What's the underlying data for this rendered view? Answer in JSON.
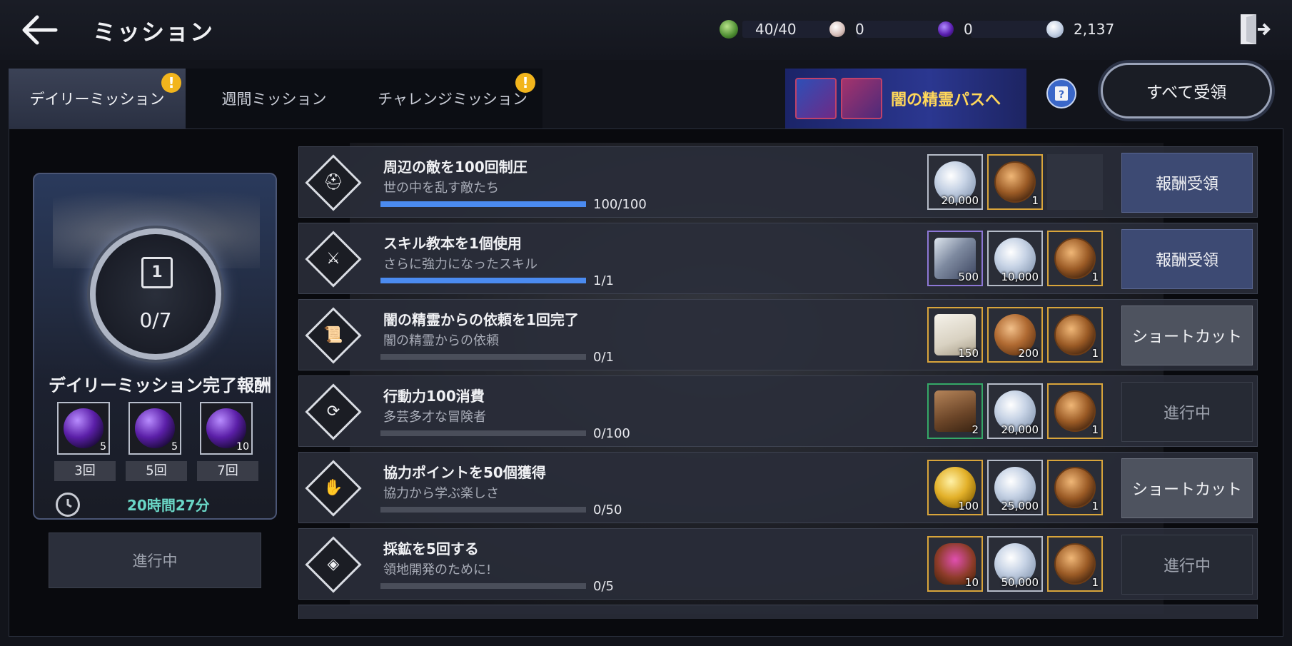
{
  "header": {
    "title": "ミッション",
    "currencies": [
      {
        "icon": "stamina-icon",
        "value": "40/40",
        "color": "#5ea64c"
      },
      {
        "icon": "pearl-icon",
        "value": "0",
        "color": "#e8d6d2"
      },
      {
        "icon": "dark-orb-icon",
        "value": "0",
        "color": "#6a2bc4"
      },
      {
        "icon": "silver-coin-icon",
        "value": "2,137",
        "color": "#c8d4e6"
      }
    ]
  },
  "tabs": [
    {
      "label": "デイリーミッション",
      "active": true,
      "alert": "!"
    },
    {
      "label": "週間ミッション",
      "active": false,
      "alert": ""
    },
    {
      "label": "チャレンジミッション",
      "active": false,
      "alert": "!"
    }
  ],
  "pass_banner": {
    "label": "闇の精霊パスへ"
  },
  "claim_all": {
    "label": "すべて受領"
  },
  "daily_panel": {
    "medal_number": "1",
    "progress": "0/7",
    "title": "デイリーミッション完了報酬",
    "rewards": [
      {
        "count": "5",
        "label": "3回"
      },
      {
        "count": "5",
        "label": "5回"
      },
      {
        "count": "10",
        "label": "7回"
      }
    ],
    "timer": "20時間27分",
    "status_button": "進行中"
  },
  "missions": [
    {
      "title": "周辺の敵を100回制圧",
      "subtitle": "世の中を乱す敵たち",
      "progress_text": "100/100",
      "progress_ratio": 1.0,
      "emblem": "helmet-icon",
      "rewards": [
        {
          "type": "silver",
          "count": "20,000"
        },
        {
          "type": "medal",
          "count": "1"
        }
      ],
      "action": "報酬受領",
      "action_state": "claim"
    },
    {
      "title": "スキル教本を1個使用",
      "subtitle": "さらに強力になったスキル",
      "progress_text": "1/1",
      "progress_ratio": 1.0,
      "emblem": "crossed-swords-icon",
      "rewards": [
        {
          "type": "crystal",
          "count": "500"
        },
        {
          "type": "silver",
          "count": "10,000"
        },
        {
          "type": "medal",
          "count": "1"
        }
      ],
      "action": "報酬受領",
      "action_state": "claim"
    },
    {
      "title": "闇の精霊からの依頼を1回完了",
      "subtitle": "闇の精霊からの依頼",
      "progress_text": "0/1",
      "progress_ratio": 0,
      "emblem": "scroll-icon",
      "rewards": [
        {
          "type": "scroll",
          "count": "150"
        },
        {
          "type": "bronze",
          "count": "200"
        },
        {
          "type": "medal",
          "count": "1"
        }
      ],
      "action": "ショートカット",
      "action_state": "shortcut"
    },
    {
      "title": "行動力100消費",
      "subtitle": "多芸多才な冒険者",
      "progress_text": "0/100",
      "progress_ratio": 0,
      "emblem": "refresh-icon",
      "rewards": [
        {
          "type": "chest",
          "count": "2"
        },
        {
          "type": "silver",
          "count": "20,000"
        },
        {
          "type": "medal",
          "count": "1"
        }
      ],
      "action": "進行中",
      "action_state": "progress"
    },
    {
      "title": "協力ポイントを50個獲得",
      "subtitle": "協力から学ぶ楽しさ",
      "progress_text": "0/50",
      "progress_ratio": 0,
      "emblem": "hand-icon",
      "rewards": [
        {
          "type": "gold",
          "count": "100"
        },
        {
          "type": "silver",
          "count": "25,000"
        },
        {
          "type": "medal",
          "count": "1"
        }
      ],
      "action": "ショートカット",
      "action_state": "shortcut"
    },
    {
      "title": "採鉱を5回する",
      "subtitle": "領地開発のために!",
      "progress_text": "0/5",
      "progress_ratio": 0,
      "emblem": "mining-icon",
      "rewards": [
        {
          "type": "pouch",
          "count": "10"
        },
        {
          "type": "silver",
          "count": "50,000"
        },
        {
          "type": "medal",
          "count": "1"
        }
      ],
      "action": "進行中",
      "action_state": "progress"
    }
  ]
}
